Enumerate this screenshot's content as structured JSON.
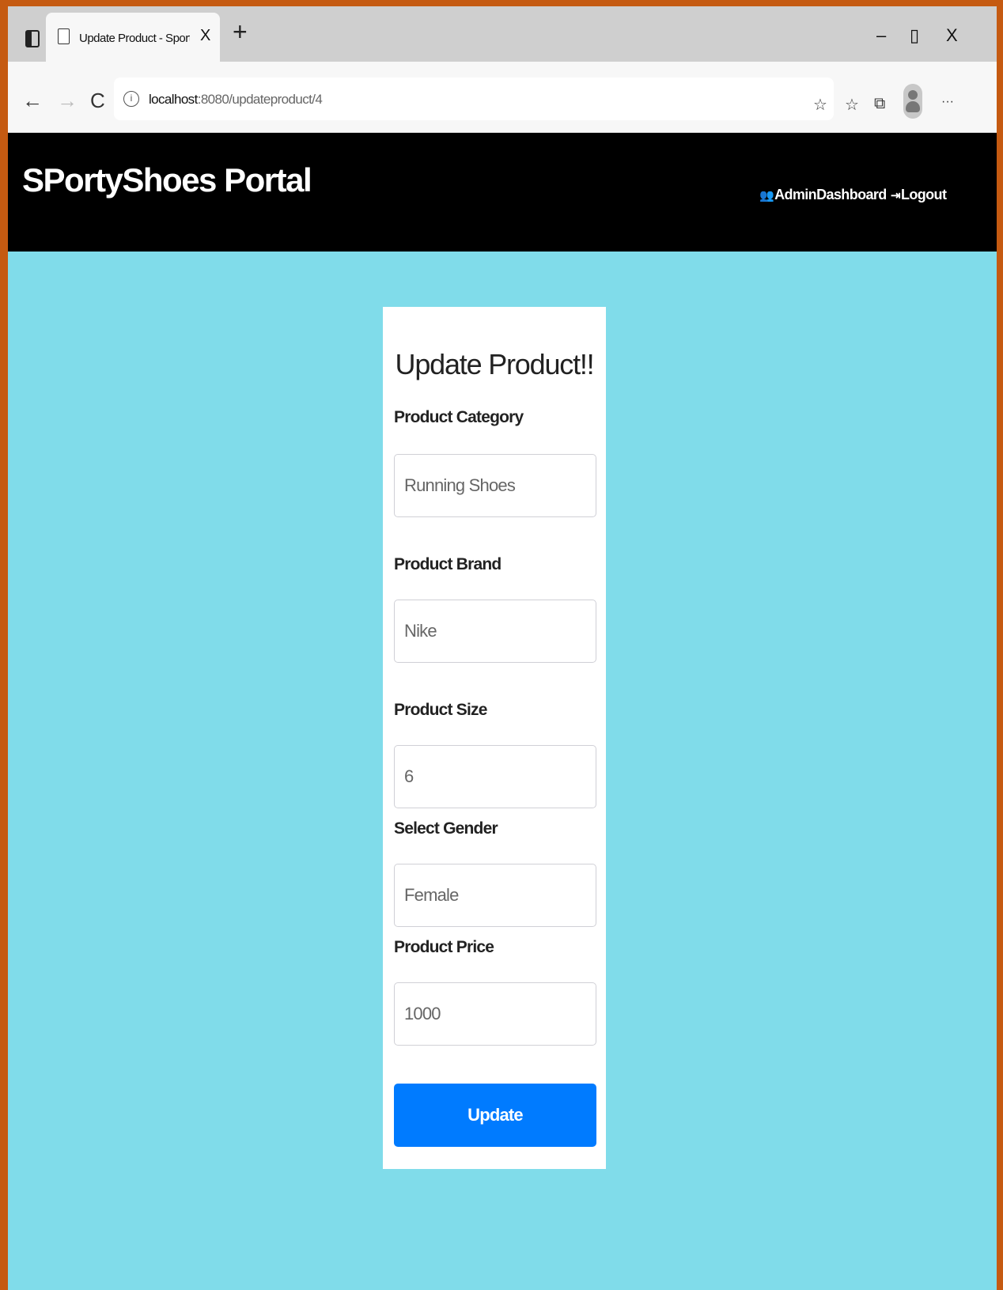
{
  "browser": {
    "tab_title": "Update Product - SportyShoes.co",
    "tab_close": "X",
    "new_tab": "+",
    "minimize": "–",
    "restore": "▯",
    "close": "X",
    "back": "←",
    "forward": "→",
    "reload": "C",
    "info": "i",
    "url_host": "localhost",
    "url_path": ":8080/updateproduct/4",
    "more": "···"
  },
  "navbar": {
    "brand": "SPortyShoes Portal",
    "admin_dashboard": "AdminDashboard",
    "logout": "Logout"
  },
  "form": {
    "heading": "Update Product!!",
    "category_label": "Product Category",
    "category_value": "Running Shoes",
    "brand_label": "Product Brand",
    "brand_value": "Nike",
    "size_label": "Product Size",
    "size_value": "6",
    "gender_label": "Select Gender",
    "gender_value": "Female",
    "price_label": "Product Price",
    "price_value": "1000",
    "submit_label": "Update"
  },
  "colors": {
    "page_background": "#80dcea",
    "navbar_background": "#000000",
    "button_primary": "#007bff",
    "frame_border": "#c55a11"
  }
}
